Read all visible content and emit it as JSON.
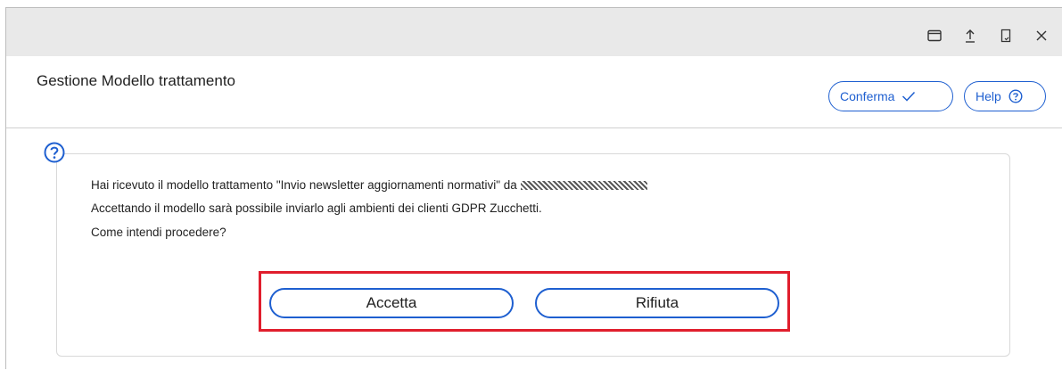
{
  "window": {
    "controls": [
      {
        "name": "restore",
        "icon": "window-icon"
      },
      {
        "name": "upload",
        "icon": "upload-icon"
      },
      {
        "name": "bookmark",
        "icon": "bookmark-icon"
      },
      {
        "name": "close",
        "icon": "close-icon"
      }
    ]
  },
  "header": {
    "title": "Gestione Modello trattamento",
    "confirm_label": "Conferma",
    "help_label": "Help"
  },
  "dialog": {
    "line1": "Hai ricevuto il modello trattamento \"Invio newsletter aggiornamenti normativi\" da",
    "line2": "Accettando il modello sarà possibile inviarlo agli ambienti dei clienti GDPR Zucchetti.",
    "line3": "Come intendi procedere?",
    "accept_label": "Accetta",
    "reject_label": "Rifiuta"
  },
  "colors": {
    "accent": "#1e5fd0",
    "highlight": "#e01e2d"
  }
}
